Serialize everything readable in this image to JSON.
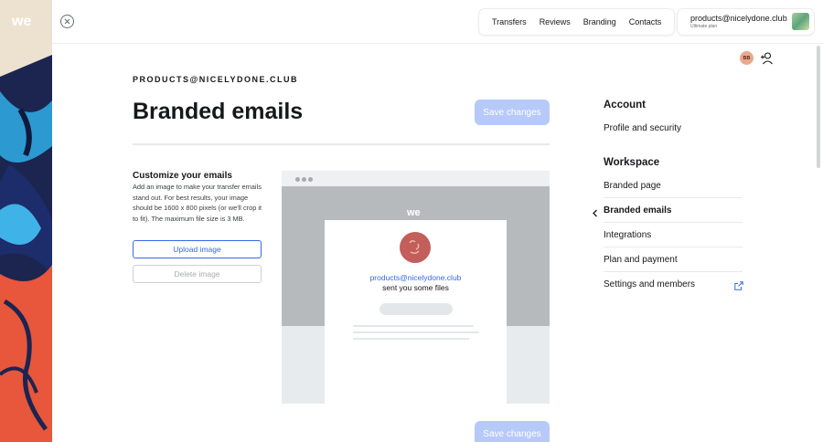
{
  "header": {
    "nav": [
      "Transfers",
      "Reviews",
      "Branding",
      "Contacts"
    ],
    "account_email": "products@nicelydone.club",
    "account_plan": "Ultimate plan",
    "avatar_initials": "BB"
  },
  "page": {
    "kicker": "PRODUCTS@NICELYDONE.CLUB",
    "title": "Branded emails",
    "save_label": "Save changes"
  },
  "customize": {
    "title": "Customize your emails",
    "description": "Add an image to make your transfer emails stand out. For best results, your image should be 1600 x 800 pixels (or we'll crop it to fit). The maximum file size is 3 MB.",
    "upload_label": "Upload image",
    "delete_label": "Delete image"
  },
  "preview": {
    "sender": "products@nicelydone.club",
    "subtitle": "sent you some files"
  },
  "settings_nav": {
    "account_heading": "Account",
    "account_items": [
      "Profile and security"
    ],
    "workspace_heading": "Workspace",
    "workspace_items": [
      "Branded page",
      "Branded emails",
      "Integrations",
      "Plan and payment",
      "Settings and members"
    ],
    "active_item": "Branded emails"
  },
  "colors": {
    "accent": "#3767e6",
    "save_button": "#b7c9f9",
    "preview_avatar": "#c35e5a"
  }
}
